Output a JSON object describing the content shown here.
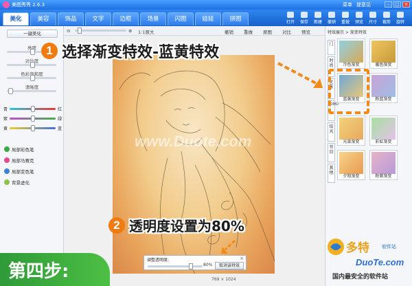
{
  "window": {
    "title": "美图秀秀 2.6.3",
    "links": [
      "菜单",
      "提意见"
    ]
  },
  "tabs": [
    {
      "label": "美化",
      "active": true
    },
    {
      "label": "美容",
      "active": false
    },
    {
      "label": "饰品",
      "active": false
    },
    {
      "label": "文字",
      "active": false
    },
    {
      "label": "边框",
      "active": false
    },
    {
      "label": "场景",
      "active": false
    },
    {
      "label": "闪图",
      "active": false
    },
    {
      "label": "娃娃",
      "active": false
    },
    {
      "label": "拼图",
      "active": false
    }
  ],
  "toolbar_buttons": [
    "打开",
    "保存",
    "新建",
    "撤销",
    "重做",
    "预览",
    "尺寸",
    "裁剪",
    "旋转"
  ],
  "left_panel": {
    "auto_button": "一键美化",
    "adjustments": [
      "亮度",
      "对比度",
      "色彩饱和度",
      "清晰度"
    ],
    "color_balance": [
      {
        "left": "青",
        "right": "红"
      },
      {
        "left": "紫",
        "right": "绿"
      },
      {
        "left": "黄",
        "right": "蓝"
      }
    ],
    "tools": [
      {
        "label": "局部彩色笔",
        "color": "#3aa84a"
      },
      {
        "label": "局部马赛克",
        "color": "#e24b8b"
      },
      {
        "label": "局部变色笔",
        "color": "#3b82d8"
      },
      {
        "label": "背景虚化",
        "color": "#8bc34a"
      }
    ]
  },
  "canvas_bar": {
    "zoom": "1:1原大",
    "actions": [
      "撤销",
      "重做",
      "原图",
      "对比",
      "预览"
    ]
  },
  "right_panel": {
    "header": "特效展示 > 渐变特效",
    "vertical_tabs": [
      "门",
      "时尚",
      "艺术",
      "LOMO",
      "炫光",
      "节日",
      "其他"
    ],
    "effects": [
      {
        "label": "冷色渐变",
        "c1": "#8fd1e0",
        "c2": "#d9a95a"
      },
      {
        "label": "暖色渐变",
        "c1": "#f0c560",
        "c2": "#c59a3a"
      },
      {
        "label": "蓝黄渐变",
        "c1": "#6ea8d8",
        "c2": "#e9c878"
      },
      {
        "label": "粉蓝渐变",
        "c1": "#c9a2d9",
        "c2": "#9fbfe3"
      },
      {
        "label": "光束渐变",
        "c1": "#f4d27a",
        "c2": "#e6a85e"
      },
      {
        "label": "彩虹渐变",
        "c1": "#a6e0a0",
        "c2": "#e3c2e8"
      },
      {
        "label": "夕阳渐变",
        "c1": "#f6d48c",
        "c2": "#e99a4e"
      },
      {
        "label": "粉紫渐变",
        "c1": "#e7b3c9",
        "c2": "#b79ad8"
      }
    ]
  },
  "opacity_box": {
    "label": "调整透明度:",
    "value": "80%",
    "cancel": "取消该特效"
  },
  "dimensions": "769 × 1024",
  "callouts": {
    "step1_number": "1",
    "step1_text": "选择渐变特效-蓝黄特效",
    "step2_number": "2",
    "step2_text": "透明度设置为80%"
  },
  "step_banner": "第四步:",
  "watermark": "www.Duote.com",
  "site_logo": {
    "title": "多特",
    "sub": "软件站",
    "url": "DuoTe.com",
    "motto": "国内最安全的软件站"
  },
  "colors": {
    "accent": "#1b6fe3",
    "callout_orange": "#ef7b11",
    "banner_green": "#3aad3d"
  }
}
